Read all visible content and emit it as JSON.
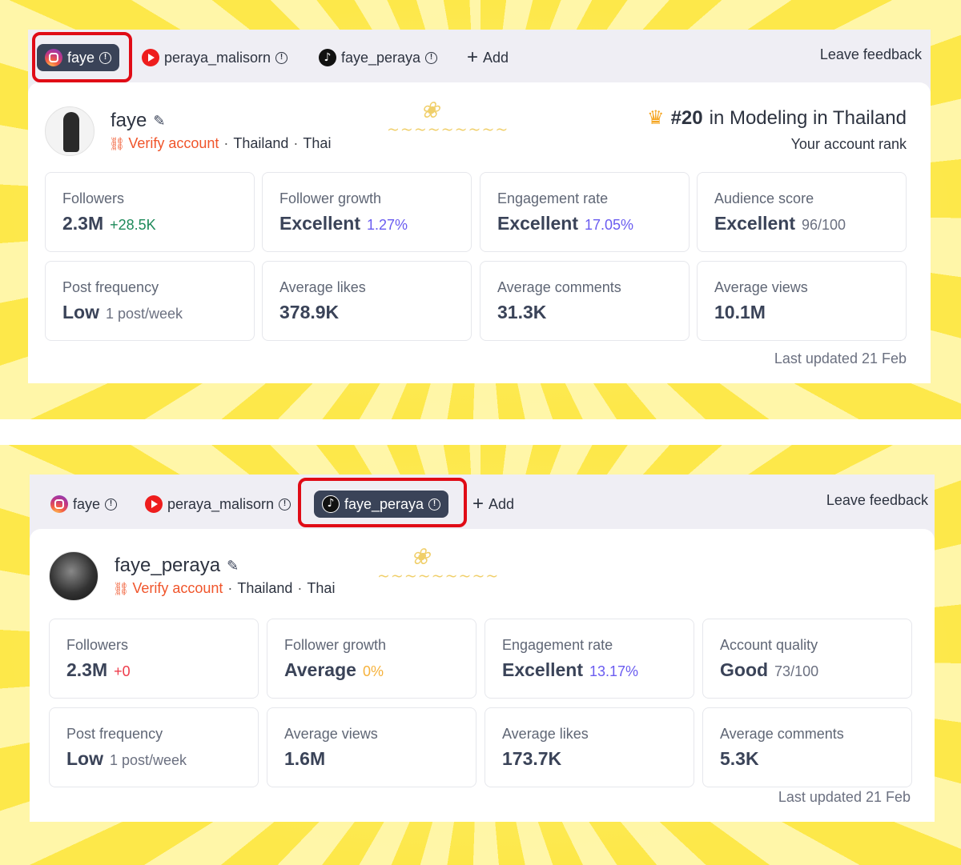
{
  "panels": [
    {
      "tabs": [
        {
          "label": "faye",
          "icon": "instagram-icon",
          "active": true
        },
        {
          "label": "peraya_malisorn",
          "icon": "youtube-icon",
          "active": false
        },
        {
          "label": "faye_peraya",
          "icon": "tiktok-icon",
          "active": false
        }
      ],
      "add_label": "Add",
      "feedback_label": "Leave feedback",
      "profile": {
        "name": "faye",
        "verify_label": "Verify account",
        "country": "Thailand",
        "language": "Thai"
      },
      "rank": {
        "number": "#20",
        "text": "in Modeling in Thailand",
        "subtitle": "Your account rank"
      },
      "metrics": [
        {
          "label": "Followers",
          "value": "2.3M",
          "sub": "+28.5K",
          "sub_color": "green"
        },
        {
          "label": "Follower growth",
          "value": "Excellent",
          "sub": "1.27%",
          "sub_color": "purple"
        },
        {
          "label": "Engagement rate",
          "value": "Excellent",
          "sub": "17.05%",
          "sub_color": "purple"
        },
        {
          "label": "Audience score",
          "value": "Excellent",
          "sub": "96/100",
          "sub_color": "gray"
        },
        {
          "label": "Post frequency",
          "value": "Low",
          "sub": "1 post/week",
          "sub_color": "gray"
        },
        {
          "label": "Average likes",
          "value": "378.9K",
          "sub": "",
          "sub_color": "gray"
        },
        {
          "label": "Average comments",
          "value": "31.3K",
          "sub": "",
          "sub_color": "gray"
        },
        {
          "label": "Average views",
          "value": "10.1M",
          "sub": "",
          "sub_color": "gray"
        }
      ],
      "updated": "Last updated 21 Feb"
    },
    {
      "tabs": [
        {
          "label": "faye",
          "icon": "instagram-icon",
          "active": false
        },
        {
          "label": "peraya_malisorn",
          "icon": "youtube-icon",
          "active": false
        },
        {
          "label": "faye_peraya",
          "icon": "tiktok-icon",
          "active": true
        }
      ],
      "add_label": "Add",
      "feedback_label": "Leave feedback",
      "profile": {
        "name": "faye_peraya",
        "verify_label": "Verify account",
        "country": "Thailand",
        "language": "Thai"
      },
      "metrics": [
        {
          "label": "Followers",
          "value": "2.3M",
          "sub": "+0",
          "sub_color": "red"
        },
        {
          "label": "Follower growth",
          "value": "Average",
          "sub": "0%",
          "sub_color": "orange"
        },
        {
          "label": "Engagement rate",
          "value": "Excellent",
          "sub": "13.17%",
          "sub_color": "purple"
        },
        {
          "label": "Account quality",
          "value": "Good",
          "sub": "73/100",
          "sub_color": "gray"
        },
        {
          "label": "Post frequency",
          "value": "Low",
          "sub": "1 post/week",
          "sub_color": "gray"
        },
        {
          "label": "Average views",
          "value": "1.6M",
          "sub": "",
          "sub_color": "gray"
        },
        {
          "label": "Average likes",
          "value": "173.7K",
          "sub": "",
          "sub_color": "gray"
        },
        {
          "label": "Average comments",
          "value": "5.3K",
          "sub": "",
          "sub_color": "gray"
        }
      ],
      "updated": "Last updated 21 Feb"
    }
  ],
  "colors": {
    "active_tab": "#3a4358",
    "highlight": "#e00b16",
    "verify": "#f0552b",
    "background_rays": "#fde84a"
  }
}
